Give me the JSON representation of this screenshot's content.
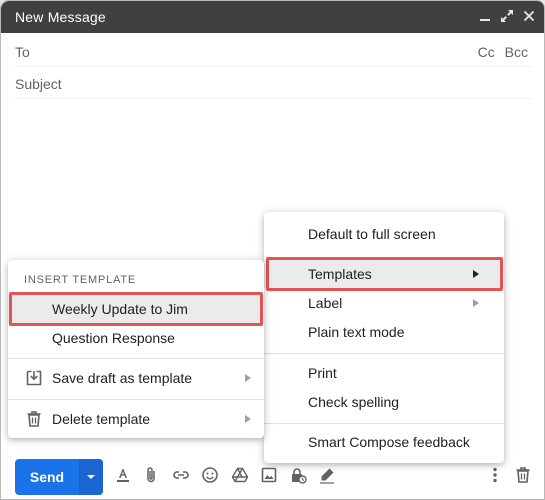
{
  "window": {
    "title": "New Message"
  },
  "fields": {
    "to_label": "To",
    "cc_label": "Cc",
    "bcc_label": "Bcc",
    "subject_placeholder": "Subject"
  },
  "toolbar": {
    "send_label": "Send"
  },
  "more_menu": {
    "items": [
      {
        "label": "Default to full screen"
      },
      {
        "label": "Templates",
        "has_submenu": true,
        "highlighted": true
      },
      {
        "label": "Label",
        "has_submenu": true
      },
      {
        "label": "Plain text mode"
      },
      {
        "label": "Print"
      },
      {
        "label": "Check spelling"
      },
      {
        "label": "Smart Compose feedback"
      }
    ]
  },
  "templates_menu": {
    "heading": "INSERT TEMPLATE",
    "items": [
      {
        "label": "Weekly Update to Jim",
        "highlighted": true
      },
      {
        "label": "Question Response"
      },
      {
        "label": "Save draft as template",
        "icon": "save-template-icon",
        "has_submenu": true
      },
      {
        "label": "Delete template",
        "icon": "trash-icon",
        "has_submenu": true
      }
    ]
  },
  "colors": {
    "titlebar": "#404040",
    "send_button": "#1a73e8",
    "highlight_box": "#e25652",
    "menu_highlight": "#ebebeb"
  }
}
